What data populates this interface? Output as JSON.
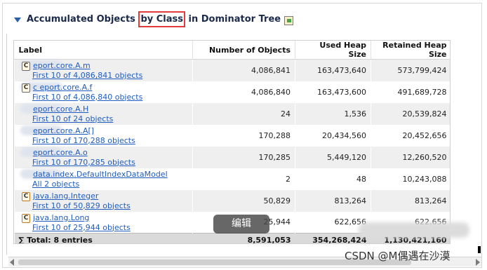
{
  "header": {
    "title_before": "Accumulated Objects ",
    "title_highlight": "by Class",
    "title_after": " in Dominator Tree",
    "icon": "export-icon"
  },
  "table": {
    "columns": [
      "Label",
      "Number of Objects",
      "Used Heap Size",
      "Retained Heap Size"
    ],
    "rows": [
      {
        "icon": "class-icon",
        "name": "eport.core.A.m",
        "sub": "First 10 of 4,086,841 objects",
        "objects": "4,086,841",
        "used": "163,473,640",
        "retained": "573,799,424"
      },
      {
        "icon": "class-icon",
        "name": "c      eport.core.A.f",
        "sub": "First 10 of 4,086,840 objects",
        "objects": "4,086,840",
        "used": "163,473,600",
        "retained": "491,689,728"
      },
      {
        "icon": "",
        "name": "eport.core.A.H",
        "sub": "First 10 of 24 objects",
        "objects": "24",
        "used": "1,536",
        "retained": "20,539,824"
      },
      {
        "icon": "",
        "name": "eport.core.A.A[]",
        "sub": "First 10 of 170,288 objects",
        "objects": "170,288",
        "used": "20,434,560",
        "retained": "20,452,656"
      },
      {
        "icon": "",
        "name": "eport.core.A.o",
        "sub": "First 10 of 170,285 objects",
        "objects": "170,285",
        "used": "5,449,120",
        "retained": "12,260,520"
      },
      {
        "icon": "",
        "name": "data.index.DefaultIndexDataModel",
        "sub": "All 2 objects",
        "objects": "2",
        "used": "48",
        "retained": "10,243,088"
      },
      {
        "icon": "class-icon-orange",
        "name": "java.lang.Integer",
        "sub": "First 10 of 50,829 objects",
        "objects": "50,829",
        "used": "813,264",
        "retained": "813,264"
      },
      {
        "icon": "class-icon-orange",
        "name": "java.lang.Long",
        "sub": "First 10 of 25,944 objects",
        "objects": "25,944",
        "used": "622,656",
        "retained": "622,656"
      }
    ],
    "total": {
      "label": "∑ Total: 8 entries",
      "objects": "8,591,053",
      "used": "354,268,424",
      "retained": "1,130,421,160"
    }
  },
  "overlay": {
    "edit_button": "编辑",
    "watermark": "CSDN @M偶遇在沙漠"
  }
}
